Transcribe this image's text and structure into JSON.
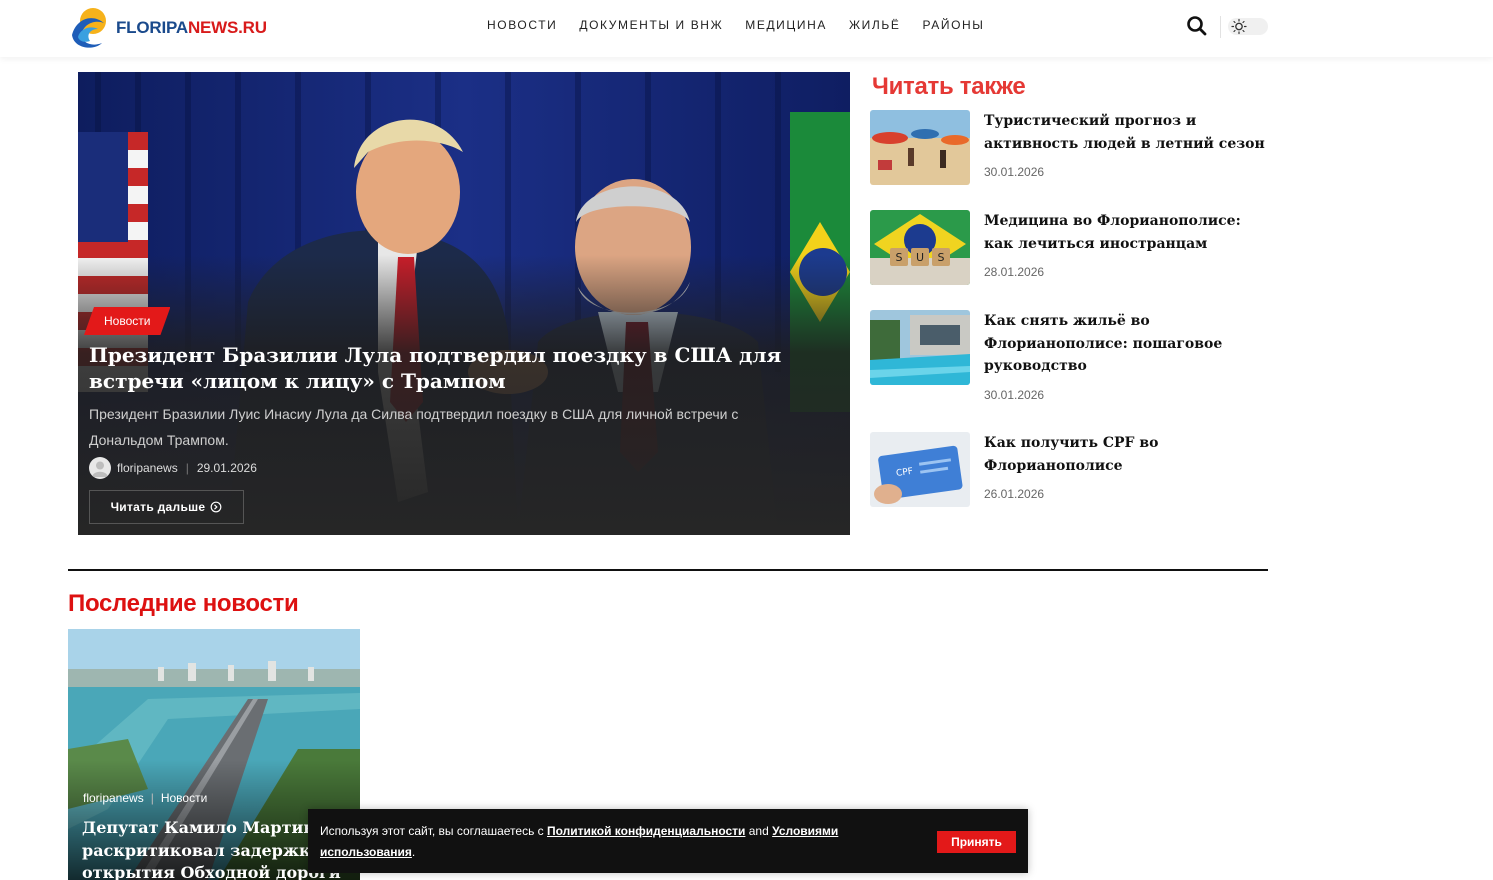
{
  "header": {
    "logo": {
      "part1": "FLORIPA",
      "part2": "NEWS.RU"
    },
    "nav": [
      "НОВОСТИ",
      "ДОКУМЕНТЫ И ВНЖ",
      "МЕДИЦИНА",
      "ЖИЛЬЁ",
      "РАЙОНЫ"
    ],
    "icons": {
      "search": "search-icon",
      "theme": "sun-icon"
    }
  },
  "hero": {
    "category": "Новости",
    "title": "Президент Бразилии Лула подтвердил поездку в США для встречи «лицом к лицу» с Трампом",
    "excerpt": "Президент Бразилии Луис Инасиу Лула да Силва подтвердил поездку в США для личной встречи с Дональдом Трампом.",
    "author": "floripanews",
    "date": "29.01.2026",
    "read_more": "Читать дальше"
  },
  "sidebar": {
    "heading": "Читать также",
    "items": [
      {
        "title": "Туристический прогноз и активность людей в летний сезон",
        "date": "30.01.2026"
      },
      {
        "title": "Медицина во Флорианополисе: как лечиться иностранцам",
        "date": "28.01.2026",
        "thumb_text": "SUS"
      },
      {
        "title": "Как снять жильё во Флорианополисе: пошаговое руководство",
        "date": "30.01.2026"
      },
      {
        "title": "Как получить CPF во Флорианополисе",
        "date": "26.01.2026",
        "thumb_text": "CPF"
      }
    ]
  },
  "latest": {
    "heading": "Последние новости",
    "card": {
      "author": "floripanews",
      "category": "Новости",
      "title": "Депутат Камило Мартинс раскритиковал задержку открытия Обходной дороги"
    }
  },
  "cookie": {
    "text1": "Используя этот сайт, вы соглашаетесь с ",
    "link1": "Политикой конфиденциальности",
    "text2": " and ",
    "link2": "Условиями использования",
    "text3": ".",
    "button": "Принять"
  },
  "colors": {
    "accent": "#e31919",
    "heading_red": "#e53935",
    "logo_blue": "#1a4a8c"
  }
}
